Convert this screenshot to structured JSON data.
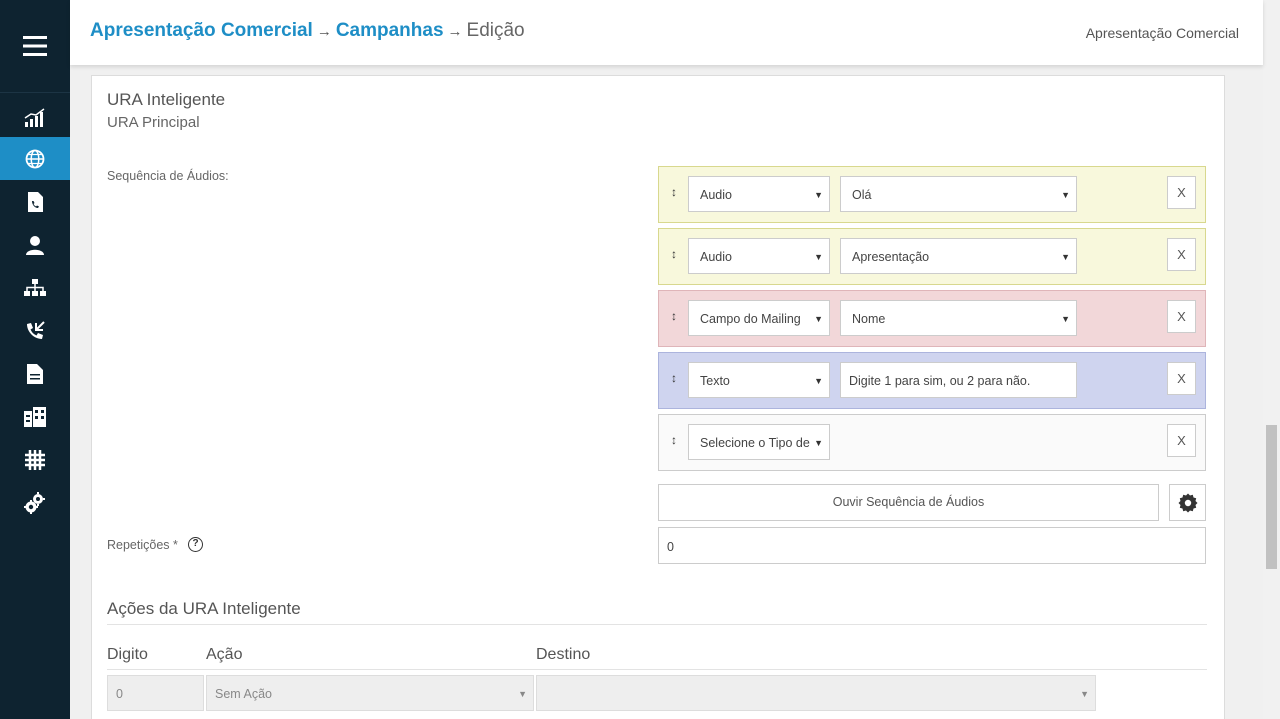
{
  "header": {
    "breadcrumb": [
      {
        "label": "Apresentação Comercial"
      },
      {
        "label": "Campanhas"
      },
      {
        "label": "Edição"
      }
    ],
    "separator": "→",
    "right_text": "Apresentação Comercial"
  },
  "sidebar": {
    "active_index": 1,
    "items": [
      {
        "icon": "chart-bars-icon"
      },
      {
        "icon": "globe-icon"
      },
      {
        "icon": "phone-document-icon"
      },
      {
        "icon": "user-icon"
      },
      {
        "icon": "org-chart-icon"
      },
      {
        "icon": "incoming-call-icon"
      },
      {
        "icon": "file-icon"
      },
      {
        "icon": "building-icon"
      },
      {
        "icon": "hash-grid-icon"
      },
      {
        "icon": "gears-icon"
      }
    ]
  },
  "ura": {
    "title": "URA Inteligente",
    "subtitle": "URA Principal",
    "sequence_label": "Sequência de Áudios:",
    "rows": [
      {
        "color": "yellow",
        "type": "Audio",
        "value": "Olá",
        "value_kind": "select",
        "remove": "X"
      },
      {
        "color": "yellow",
        "type": "Audio",
        "value": "Apresentação",
        "value_kind": "select",
        "remove": "X"
      },
      {
        "color": "red",
        "type": "Campo do Mailing",
        "value": "Nome",
        "value_kind": "select",
        "remove": "X"
      },
      {
        "color": "blue",
        "type": "Texto",
        "value": "Digite 1 para sim, ou 2 para não.",
        "value_kind": "text",
        "remove": "X"
      },
      {
        "color": "plain",
        "type": "Selecione o Tipo de",
        "value": "",
        "value_kind": "none",
        "remove": "X"
      }
    ],
    "listen_button": "Ouvir Sequência de Áudios",
    "repetitions_label": "Repetições *",
    "help_glyph": "?",
    "repetitions_value": "0"
  },
  "actions": {
    "title": "Ações da URA Inteligente",
    "columns": [
      "Digito",
      "Ação",
      "Destino"
    ],
    "row": {
      "digit": "0",
      "action": "Sem Ação",
      "destination": ""
    }
  },
  "colors": {
    "accent": "#1e8ec6",
    "sidebar_bg": "#0e2330",
    "row_yellow": "#f8f8dc",
    "row_red": "#f2d7d9",
    "row_blue": "#cfd4ef"
  }
}
